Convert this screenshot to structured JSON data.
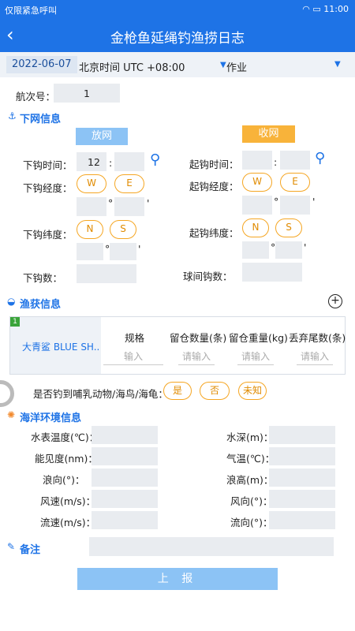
{
  "status": {
    "left": "仅限紧急呼叫",
    "time": "11:00"
  },
  "header": {
    "title": "金枪鱼延绳钓渔捞日志"
  },
  "datebar": {
    "date": "2022-06-07",
    "timezone": "北京时间 UTC +08:00",
    "mode": "作业"
  },
  "voyage": {
    "label": "航次号：",
    "value": "1"
  },
  "setting": {
    "section_title": "下网信息",
    "set_button": "放网",
    "haul_button": "收网",
    "hook_time_label": "下钩时间：",
    "hook_time_hour": "12",
    "colon": ":",
    "hook_lon_label": "下钩经度：",
    "hook_lat_label": "下钩纬度：",
    "hook_count_label": "下钩数：",
    "lift_time_label": "起钩时间：",
    "lift_lon_label": "起钩经度：",
    "lift_lat_label": "起钩纬度：",
    "hooks_between_floats_label": "球间钩数：",
    "W": "W",
    "E": "E",
    "N": "N",
    "S": "S",
    "deg": "°",
    "min": "'"
  },
  "catch": {
    "section_title": "渔获信息",
    "row_index": "1",
    "species": "大青鲨 BLUE SH..",
    "headers": [
      "规格",
      "留仓数量(条)",
      "留仓重量(kg)",
      "丢弃尾数(条)"
    ],
    "placeholders": [
      "输入",
      "请输入",
      "请输入",
      "请输入"
    ]
  },
  "bycatch": {
    "question": "是否钓到哺乳动物/海鸟/海龟：",
    "options": [
      "是",
      "否",
      "未知"
    ]
  },
  "env": {
    "section_title": "海洋环境信息",
    "left": [
      "水表温度(℃)：",
      "能见度(nm)：",
      "浪向(°)：",
      "风速(m/s)：",
      "流速(m/s)："
    ],
    "right": [
      "水深(m)：",
      "气温(℃)：",
      "浪高(m)：",
      "风向(°)：",
      "流向(°)："
    ]
  },
  "remark": {
    "section_title": "备注"
  },
  "submit": {
    "label": "上 报"
  },
  "colors": {
    "primary": "#1e73e6",
    "accent": "#f5a623"
  }
}
